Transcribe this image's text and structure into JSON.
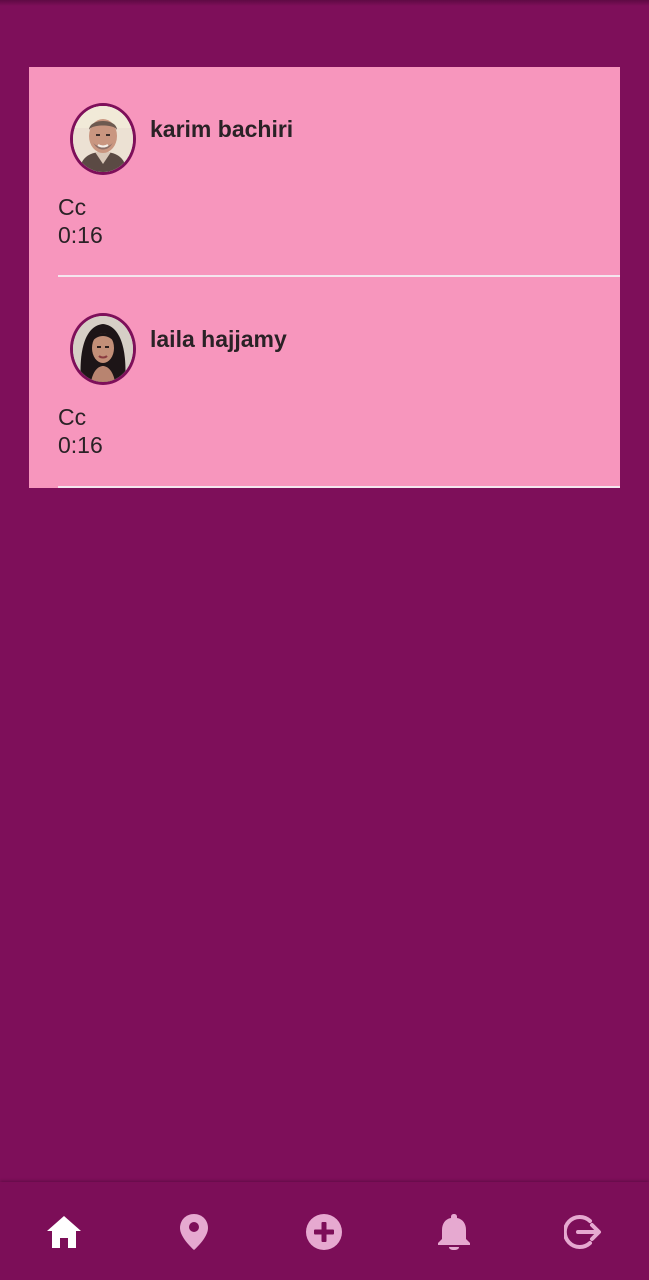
{
  "posts": [
    {
      "author": "karim bachiri",
      "text": "Cc",
      "time": "0:16",
      "avatar": "man-portrait-avatar"
    },
    {
      "author": "laila hajjamy",
      "text": "Cc",
      "time": "0:16",
      "avatar": "woman-portrait-avatar"
    }
  ],
  "nav": [
    {
      "icon": "home-icon",
      "active": true
    },
    {
      "icon": "location-pin-icon",
      "active": false
    },
    {
      "icon": "add-circle-icon",
      "active": false
    },
    {
      "icon": "bell-icon",
      "active": false
    },
    {
      "icon": "logout-icon",
      "active": false
    }
  ],
  "colors": {
    "background": "#7e0f5a",
    "card": "#f796bd",
    "nav_active": "#ffffff",
    "nav_inactive": "#e6a9d0"
  }
}
